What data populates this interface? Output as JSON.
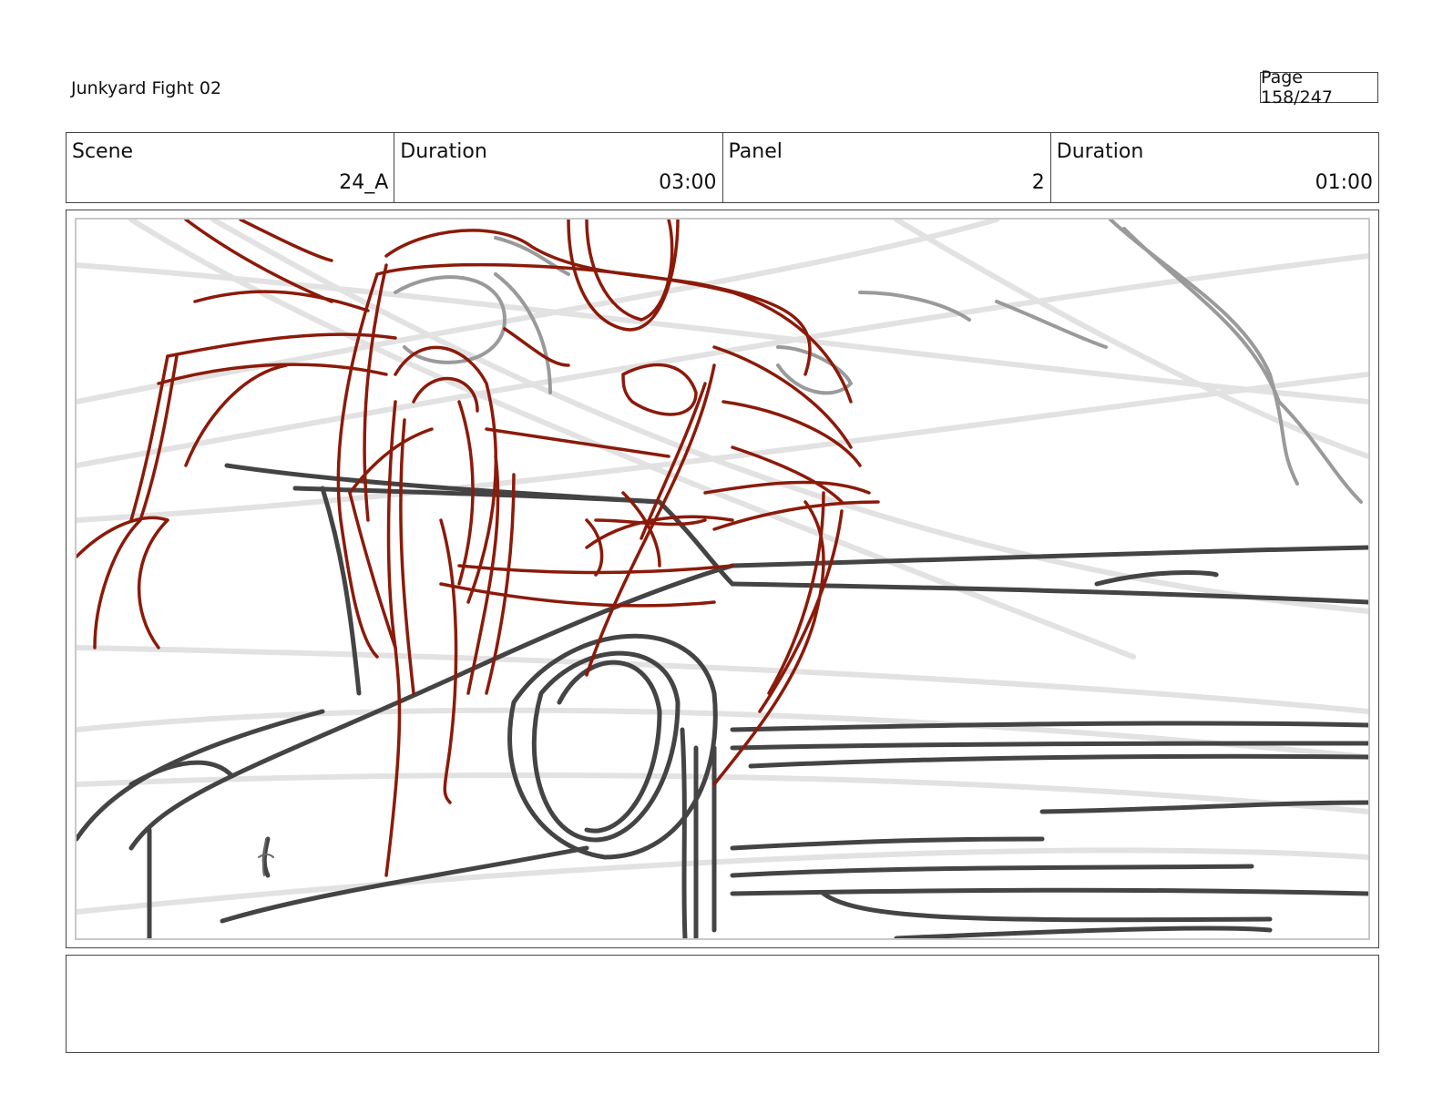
{
  "document": {
    "title": "Junkyard Fight 02",
    "page": "Page 158/247"
  },
  "info": {
    "scene_label": "Scene",
    "scene_value": "24_A",
    "scene_duration_label": "Duration",
    "scene_duration_value": "03:00",
    "panel_label": "Panel",
    "panel_value": "2",
    "panel_duration_label": "Duration",
    "panel_duration_value": "01:00"
  },
  "colors": {
    "sketch_red": "#8b1a0a",
    "sketch_dark": "#444444",
    "sketch_light": "#e2e2e2",
    "sketch_mid": "#9a9a9a"
  },
  "notes": {
    "text": ""
  }
}
